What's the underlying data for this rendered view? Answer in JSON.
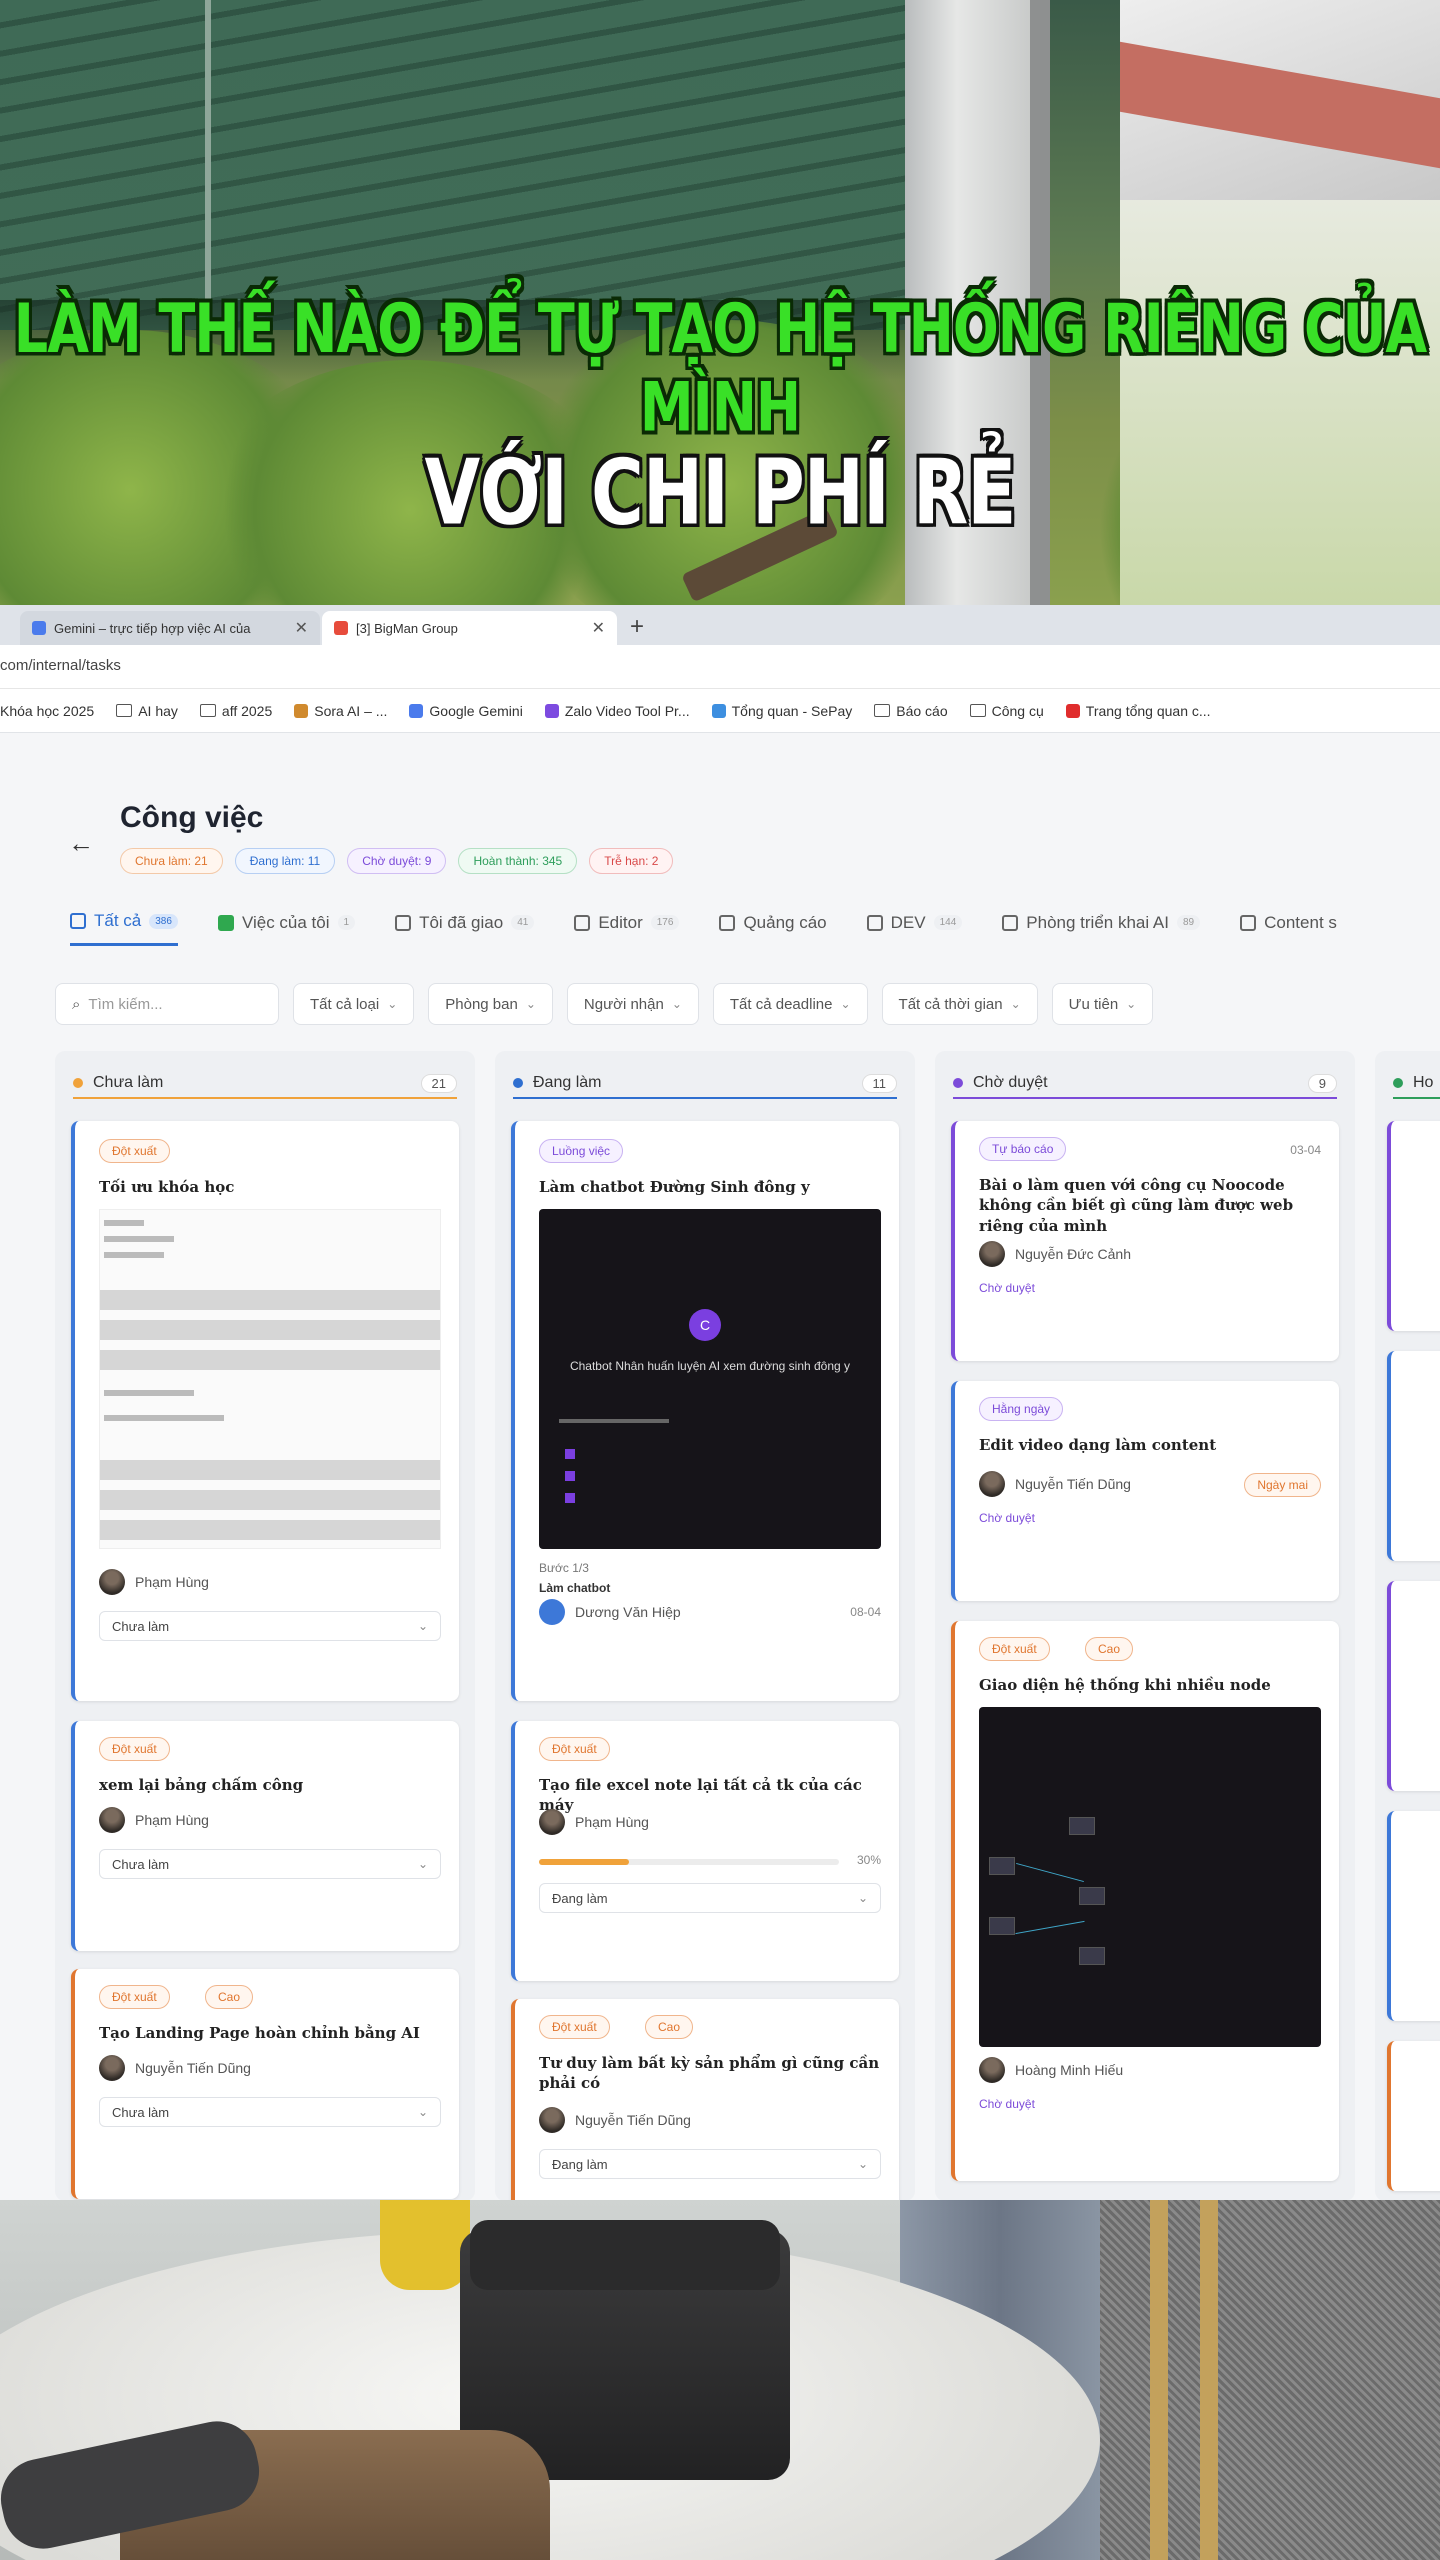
{
  "overlay": {
    "headline_line1": "LÀM THẾ NÀO ĐỂ TỰ TẠO HỆ THỐNG RIÊNG CỦA MÌNH",
    "headline_line2": "VỚI CHI PHÍ RẺ"
  },
  "browser": {
    "tabs": [
      {
        "label": "Gemini – trực tiếp hợp việc AI của",
        "icon": "gemini-icon"
      },
      {
        "label": "[3] BigMan Group",
        "icon": "bigman-icon"
      }
    ],
    "url": "com/internal/tasks",
    "bookmarks": [
      "Khóa học 2025",
      "AI hay",
      "aff 2025",
      "Sora AI – ...",
      "Google Gemini",
      "Zalo Video Tool Pr...",
      "Tổng quan - SePay",
      "Báo cáo",
      "Công cụ",
      "Trang tổng quan c..."
    ]
  },
  "app": {
    "title": "Công việc",
    "stats": [
      {
        "label": "Chưa làm: 21",
        "color": "#e0762f"
      },
      {
        "label": "Đang làm: 11",
        "color": "#2f6fd0"
      },
      {
        "label": "Chờ duyệt: 9",
        "color": "#7c4bd9"
      },
      {
        "label": "Hoàn thành: 345",
        "color": "#2e9e5b"
      },
      {
        "label": "Trễ hạn: 2",
        "color": "#d94a4a"
      }
    ],
    "view_tabs": [
      {
        "label": "Tất cả",
        "count": "386"
      },
      {
        "label": "Việc của tôi",
        "count": "1"
      },
      {
        "label": "Tôi đã giao",
        "count": "41"
      },
      {
        "label": "Editor",
        "count": "176"
      },
      {
        "label": "Quảng cáo",
        "count": ""
      },
      {
        "label": "DEV",
        "count": "144"
      },
      {
        "label": "Phòng triển khai AI",
        "count": "89"
      },
      {
        "label": "Content s",
        "count": ""
      }
    ],
    "filters": {
      "search_placeholder": "Tìm kiếm...",
      "type": "Tất cả loại",
      "department": "Phòng ban",
      "assignee": "Người nhận",
      "deadline": "Tất cả deadline",
      "time": "Tất cả thời gian",
      "priority": "Ưu tiên"
    },
    "columns": [
      {
        "name": "Chưa làm",
        "count": "21",
        "color": "#f0a23a"
      },
      {
        "name": "Đang làm",
        "count": "11",
        "color": "#2f6fd0"
      },
      {
        "name": "Chờ duyệt",
        "count": "9",
        "color": "#7c4bd9"
      },
      {
        "name": "Ho",
        "count": "",
        "color": "#2e9e5b"
      }
    ],
    "todo_cards": [
      {
        "badge": "Đột xuất",
        "title": "Tối ưu khóa học",
        "person": "Phạm Hùng",
        "status": "Chưa làm"
      },
      {
        "badge": "Đột xuất",
        "title": "xem lại bảng chấm công",
        "person": "Phạm Hùng",
        "status": "Chưa làm"
      },
      {
        "badge": "Đột xuất",
        "badge2": "Cao",
        "title": "Tạo Landing Page hoàn chỉnh bằng AI",
        "person": "Nguyễn Tiến Dũng",
        "status": "Chưa làm"
      }
    ],
    "doing_cards": [
      {
        "badge": "Luồng việc",
        "title": "Làm chatbot Đường Sinh đông y",
        "thumb_title": "Chatbot Nhân huấn luyện AI xem đường sinh đông y",
        "person_role": "Làm chatbot",
        "person": "Dương Văn Hiệp",
        "date": "08-04",
        "step": "Bước 1/3"
      },
      {
        "badge": "Đột xuất",
        "title": "Tạo file excel note lại tất cả tk của các máy",
        "person": "Phạm Hùng",
        "progress": 0.3,
        "progress_label": "30%",
        "status": "Đang làm"
      },
      {
        "badge": "Đột xuất",
        "badge2": "Cao",
        "title": "Tư duy làm bất kỳ sản phẩm gì cũng cần phải có",
        "person": "Nguyễn Tiến Dũng",
        "status": "Đang làm"
      }
    ],
    "review_cards": [
      {
        "badge": "Tự báo cáo",
        "date": "03-04",
        "title": "Bài o làm quen với công cụ Noocode không cần biết gì cũng làm được web riêng của mình",
        "person": "Nguyễn Đức Cảnh",
        "status": "Chờ duyệt"
      },
      {
        "badge": "Hằng ngày",
        "title": "Edit video dạng làm content",
        "person": "Nguyễn Tiến Dũng",
        "tag": "Ngày mai",
        "status": "Chờ duyệt"
      },
      {
        "badge": "Đột xuất",
        "badge2": "Cao",
        "title": "Giao diện hệ thống khi nhiều node",
        "person": "Hoàng Minh Hiếu",
        "status": "Chờ duyệt"
      }
    ]
  }
}
